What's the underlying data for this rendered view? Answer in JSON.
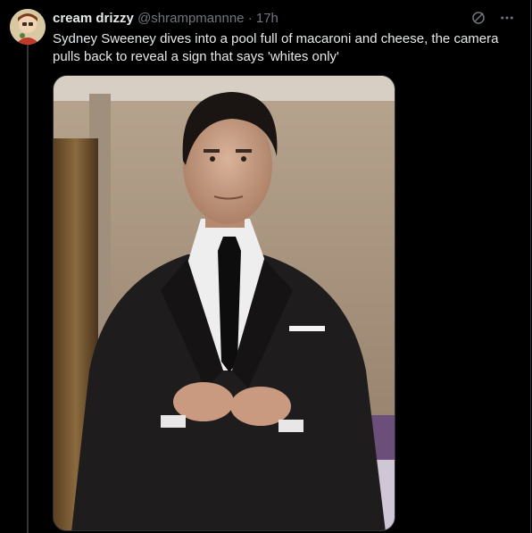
{
  "tweet": {
    "display_name": "cream drizzy",
    "handle": "@shrampmannne",
    "separator": "·",
    "timestamp": "17h",
    "text": "Sydney Sweeney dives into a pool full of macaroni and cheese, the camera pulls back to reveal a sign that says 'whites only'"
  },
  "icons": {
    "grok": "grok-icon",
    "more": "more-options-icon"
  },
  "colors": {
    "background": "#000000",
    "text_primary": "#e7e9ea",
    "text_secondary": "#71767b",
    "border": "#2f3336"
  }
}
